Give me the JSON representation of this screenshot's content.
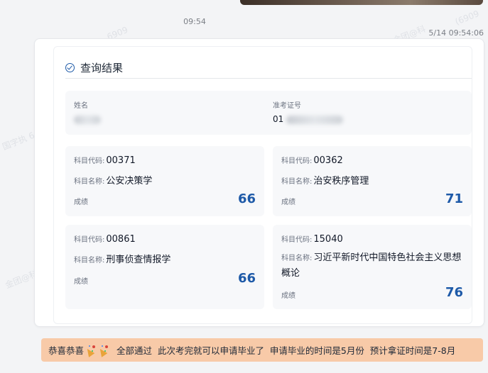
{
  "chat": {
    "time_center": "09:54",
    "time_right": "5/14 09:54:06"
  },
  "result": {
    "title": "查询结果",
    "name_label": "姓名",
    "ticket_label": "准考证号",
    "ticket_value_prefix": "01"
  },
  "subjects": [
    {
      "code_label": "科目代码:",
      "code": "00371",
      "name_label": "科目名称:",
      "name": "公安决策学",
      "score_label": "成绩",
      "score": "66"
    },
    {
      "code_label": "科目代码:",
      "code": "00362",
      "name_label": "科目名称:",
      "name": "治安秩序管理",
      "score_label": "成绩",
      "score": "71"
    },
    {
      "code_label": "科目代码:",
      "code": "00861",
      "name_label": "科目名称:",
      "name": "刑事侦查情报学",
      "score_label": "成绩",
      "score": "66"
    },
    {
      "code_label": "科目代码:",
      "code": "15040",
      "name_label": "科目名称:",
      "name": "习近平新时代中国特色社会主义思想概论",
      "score_label": "成绩",
      "score": "76"
    }
  ],
  "banner": {
    "congrats": "恭喜恭喜",
    "message": "全部通过  此次考完就可以申请毕业了  申请毕业的时间是5月份  预计拿证时间是7-8月",
    "icon": "party-popper-icon"
  },
  "watermarks": [
    "6909",
    "(6909",
    "金团@科",
    "国字执 6",
    "金团@科"
  ]
}
